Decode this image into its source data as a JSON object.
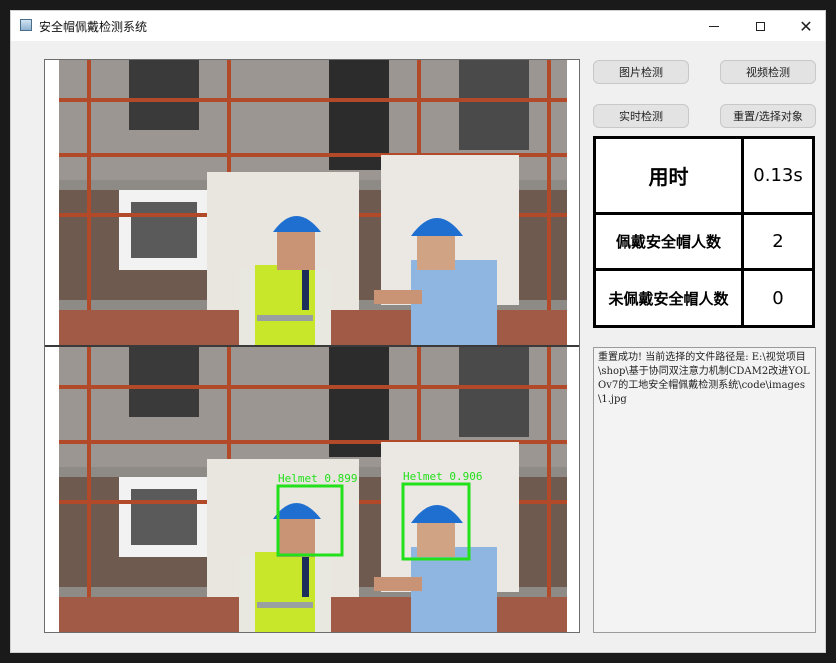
{
  "window": {
    "title": "安全帽佩戴检测系统"
  },
  "buttons": {
    "image_detect": "图片检测",
    "video_detect": "视频检测",
    "realtime_detect": "实时检测",
    "reset_select": "重置/选择对象"
  },
  "stats": {
    "time_label": "用时",
    "time_value": "0.13s",
    "wearing_label": "佩戴安全帽人数",
    "wearing_value": "2",
    "not_wearing_label": "未佩戴安全帽人数",
    "not_wearing_value": "0"
  },
  "log": {
    "text": "重置成功! 当前选择的文件路径是: E:\\视觉项目\\shop\\基于协同双注意力机制CDAM2改进YOLOv7的工地安全帽佩戴检测系统\\code\\images\\1.jpg"
  },
  "detections": [
    {
      "label": "Helmet 0.899"
    },
    {
      "label": "Helmet 0.906"
    }
  ],
  "colors": {
    "box": "#22e01a",
    "helmet": "#1f6fd0",
    "vest": "#c8e62a"
  }
}
